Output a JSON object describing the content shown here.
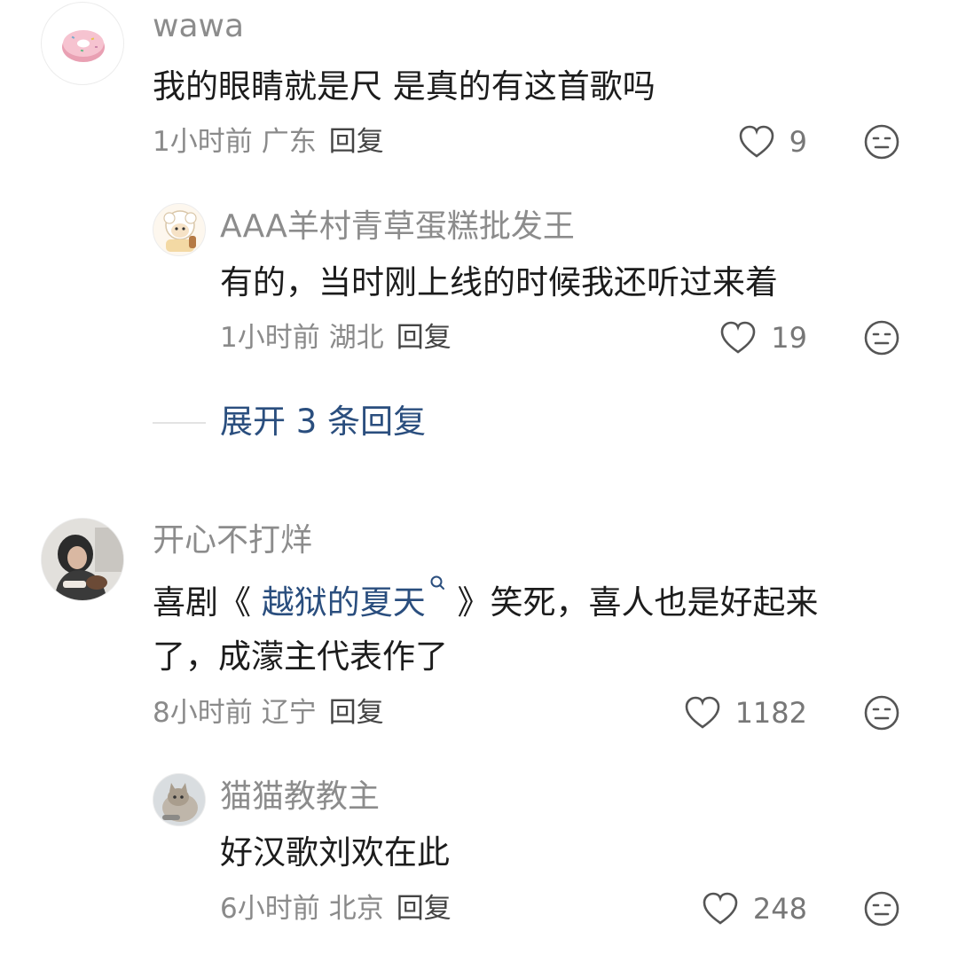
{
  "comments": [
    {
      "username": "wawa",
      "content": "我的眼睛就是尺 是真的有这首歌吗",
      "time": "1小时前",
      "location": "广东",
      "reply_label": "回复",
      "likes": "9",
      "avatar_icon": "donut-icon",
      "replies": [
        {
          "username": "AAA羊村青草蛋糕批发王",
          "content": "有的，当时刚上线的时候我还听过来着",
          "time": "1小时前",
          "location": "湖北",
          "reply_label": "回复",
          "likes": "19",
          "avatar_icon": "cartoon-sheep-icon"
        }
      ],
      "expand_label": "展开 3 条回复"
    },
    {
      "username": "开心不打烊",
      "content_line1_prefix": "喜剧《 ",
      "content_link": "越狱的夏天",
      "content_line1_suffix": " 》笑死，喜人也是好起来",
      "content_line2": "了，成濛主代表作了",
      "time": "8小时前",
      "location": "辽宁",
      "reply_label": "回复",
      "likes": "1182",
      "avatar_icon": "person-photo-icon",
      "replies": [
        {
          "username": "猫猫教教主",
          "content": "好汉歌刘欢在此",
          "time": "6小时前",
          "location": "北京",
          "reply_label": "回复",
          "likes": "248",
          "avatar_icon": "cat-photo-icon"
        }
      ]
    }
  ],
  "colors": {
    "link": "#2a4e7e",
    "meta": "#8a8a8a",
    "username": "#8c8c8c"
  }
}
